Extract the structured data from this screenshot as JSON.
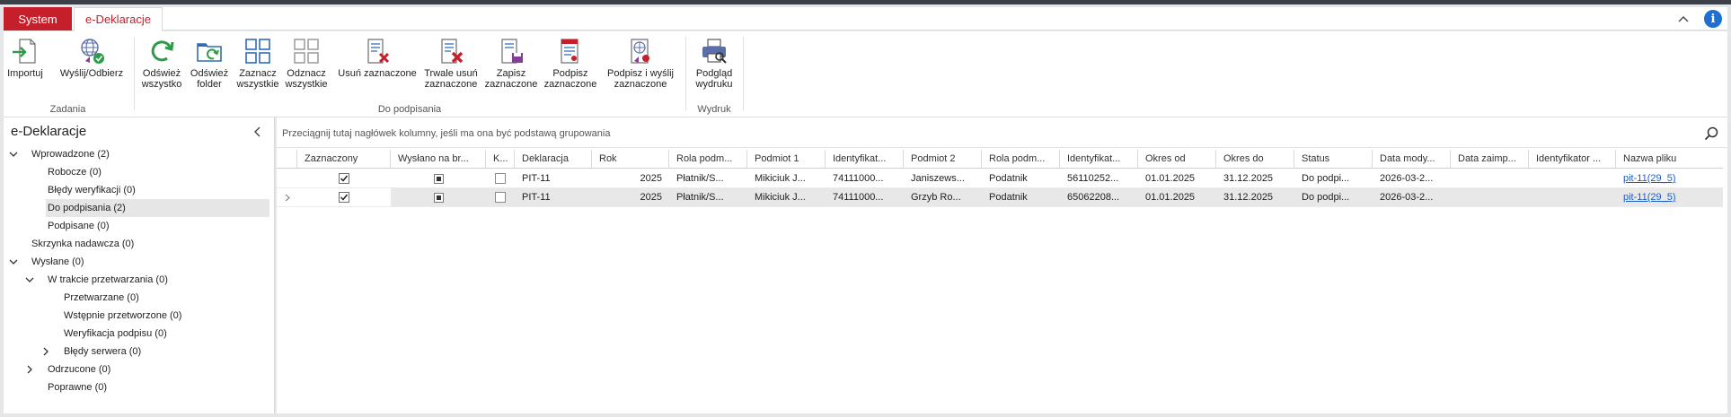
{
  "tabs": {
    "system": "System",
    "edeklaracje": "e-Deklaracje"
  },
  "info_glyph": "i",
  "colors": {
    "accent": "#c41f2b",
    "info": "#1f6fd1",
    "link": "#1f5fbf",
    "selected_row": "#e8e8e8"
  },
  "ribbon": {
    "groups": {
      "zadania": "Zadania",
      "do_podpisania": "Do podpisania",
      "wydruk": "Wydruk"
    },
    "buttons": {
      "importuj": {
        "l1": "Importuj",
        "l2": "",
        "icon": "import-icon"
      },
      "wyslij": {
        "l1": "Wyślij/Odbierz",
        "l2": "",
        "icon": "send-receive-icon"
      },
      "odswiez_wszystko": {
        "l1": "Odśwież",
        "l2": "wszystko",
        "icon": "refresh-icon"
      },
      "odswiez_folder": {
        "l1": "Odśwież",
        "l2": "folder",
        "icon": "refresh-folder-icon"
      },
      "zaznacz_wszystkie": {
        "l1": "Zaznacz",
        "l2": "wszystkie",
        "icon": "select-all-icon"
      },
      "odznacz_wszystkie": {
        "l1": "Odznacz",
        "l2": "wszystkie",
        "icon": "deselect-all-icon"
      },
      "usun_zaznaczone": {
        "l1": "Usuń zaznaczone",
        "l2": "",
        "icon": "delete-selected-icon"
      },
      "trwale_usun": {
        "l1": "Trwale usuń",
        "l2": "zaznaczone",
        "icon": "permanent-delete-icon"
      },
      "zapisz": {
        "l1": "Zapisz",
        "l2": "zaznaczone",
        "icon": "save-selected-icon"
      },
      "podpisz": {
        "l1": "Podpisz",
        "l2": "zaznaczone",
        "icon": "sign-selected-icon"
      },
      "podpisz_wyslij": {
        "l1": "Podpisz i wyślij",
        "l2": "zaznaczone",
        "icon": "sign-send-icon"
      },
      "podglad": {
        "l1": "Podgląd",
        "l2": "wydruku",
        "icon": "print-preview-icon"
      }
    }
  },
  "left": {
    "title": "e-Deklaracje",
    "tree": [
      {
        "label": "Wprowadzone (2)"
      },
      {
        "label": "Robocze (0)"
      },
      {
        "label": "Błędy weryfikacji (0)"
      },
      {
        "label": "Do podpisania (2)"
      },
      {
        "label": "Podpisane (0)"
      },
      {
        "label": "Skrzynka nadawcza (0)"
      },
      {
        "label": "Wysłane (0)"
      },
      {
        "label": "W trakcie przetwarzania (0)"
      },
      {
        "label": "Przetwarzane (0)"
      },
      {
        "label": "Wstępnie przetworzone (0)"
      },
      {
        "label": "Weryfikacja podpisu (0)"
      },
      {
        "label": "Błędy serwera (0)"
      },
      {
        "label": "Odrzucone (0)"
      },
      {
        "label": "Poprawne (0)"
      }
    ]
  },
  "grid": {
    "group_hint": "Przeciągnij tutaj nagłówek kolumny, jeśli ma ona być podstawą grupowania",
    "headers": [
      "Zaznaczony",
      "Wysłano na br...",
      "K...",
      "Deklaracja",
      "Rok",
      "Rola podm...",
      "Podmiot 1",
      "Identyfikat...",
      "Podmiot 2",
      "Rola podm...",
      "Identyfikat...",
      "Okres od",
      "Okres do",
      "Status",
      "Data mody...",
      "Data zaimp...",
      "Identyfikator ...",
      "Nazwa pliku"
    ],
    "rows": [
      {
        "deklaracja": "PIT-11",
        "rok": "2025",
        "rola1": "Płatnik/S...",
        "podmiot1": "Mikiciuk J...",
        "ident1": "74111000...",
        "podmiot2": "Janiszews...",
        "rola2": "Podatnik",
        "ident2": "56110252...",
        "okres_od": "01.01.2025",
        "okres_do": "31.12.2025",
        "status": "Do podpi...",
        "data_mod": "2026-03-2...",
        "data_imp": "",
        "identyfikator": "",
        "plik": "pit-11(29_5)"
      },
      {
        "deklaracja": "PIT-11",
        "rok": "2025",
        "rola1": "Płatnik/S...",
        "podmiot1": "Mikiciuk J...",
        "ident1": "74111000...",
        "podmiot2": "Grzyb Ro...",
        "rola2": "Podatnik",
        "ident2": "65062208...",
        "okres_od": "01.01.2025",
        "okres_do": "31.12.2025",
        "status": "Do podpi...",
        "data_mod": "2026-03-2...",
        "data_imp": "",
        "identyfikator": "",
        "plik": "pit-11(29_5)"
      }
    ]
  }
}
